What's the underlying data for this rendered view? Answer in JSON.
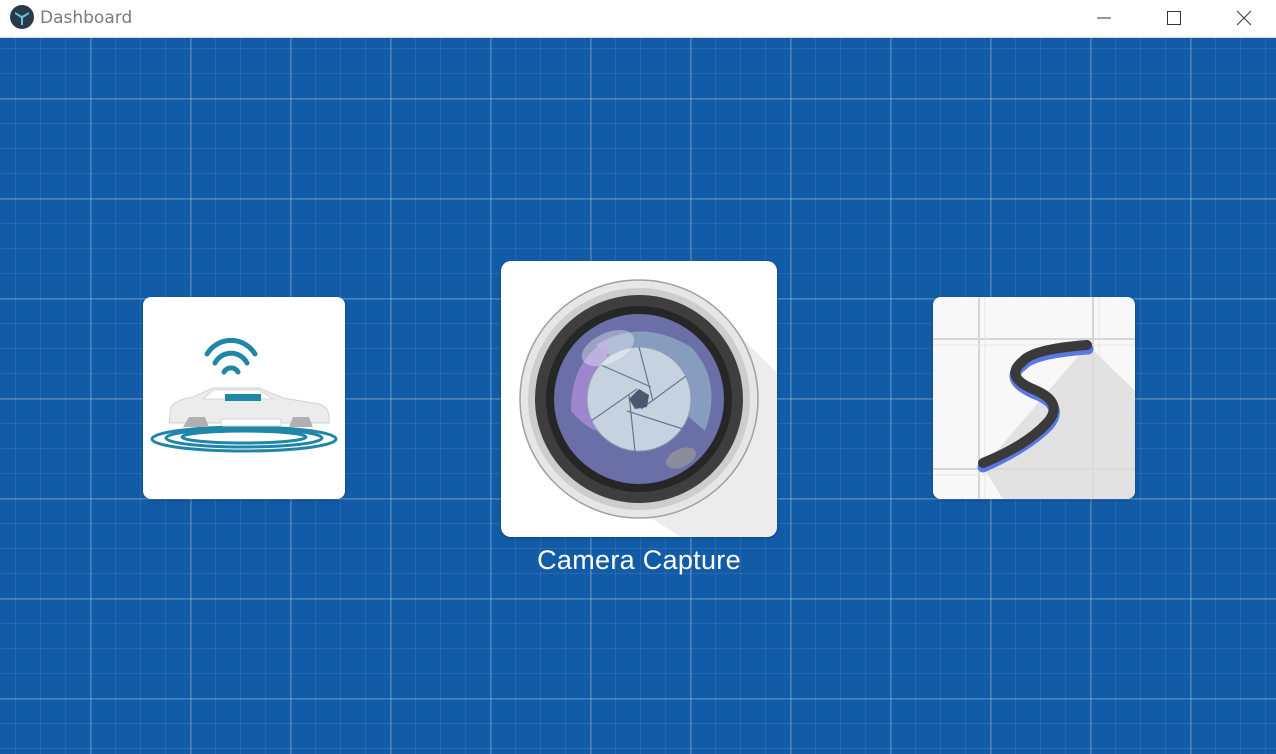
{
  "window": {
    "title": "Dashboard",
    "icons": {
      "app": "app-logo-icon",
      "minimize": "minimize-icon",
      "maximize": "maximize-icon",
      "close": "close-icon"
    }
  },
  "dashboard": {
    "background_color": "#125ba7",
    "tiles": [
      {
        "icon": "wireless-car-icon",
        "caption": ""
      },
      {
        "icon": "camera-lens-icon",
        "caption": "Camera Capture"
      },
      {
        "icon": "ink-stroke-icon",
        "caption": ""
      }
    ]
  }
}
